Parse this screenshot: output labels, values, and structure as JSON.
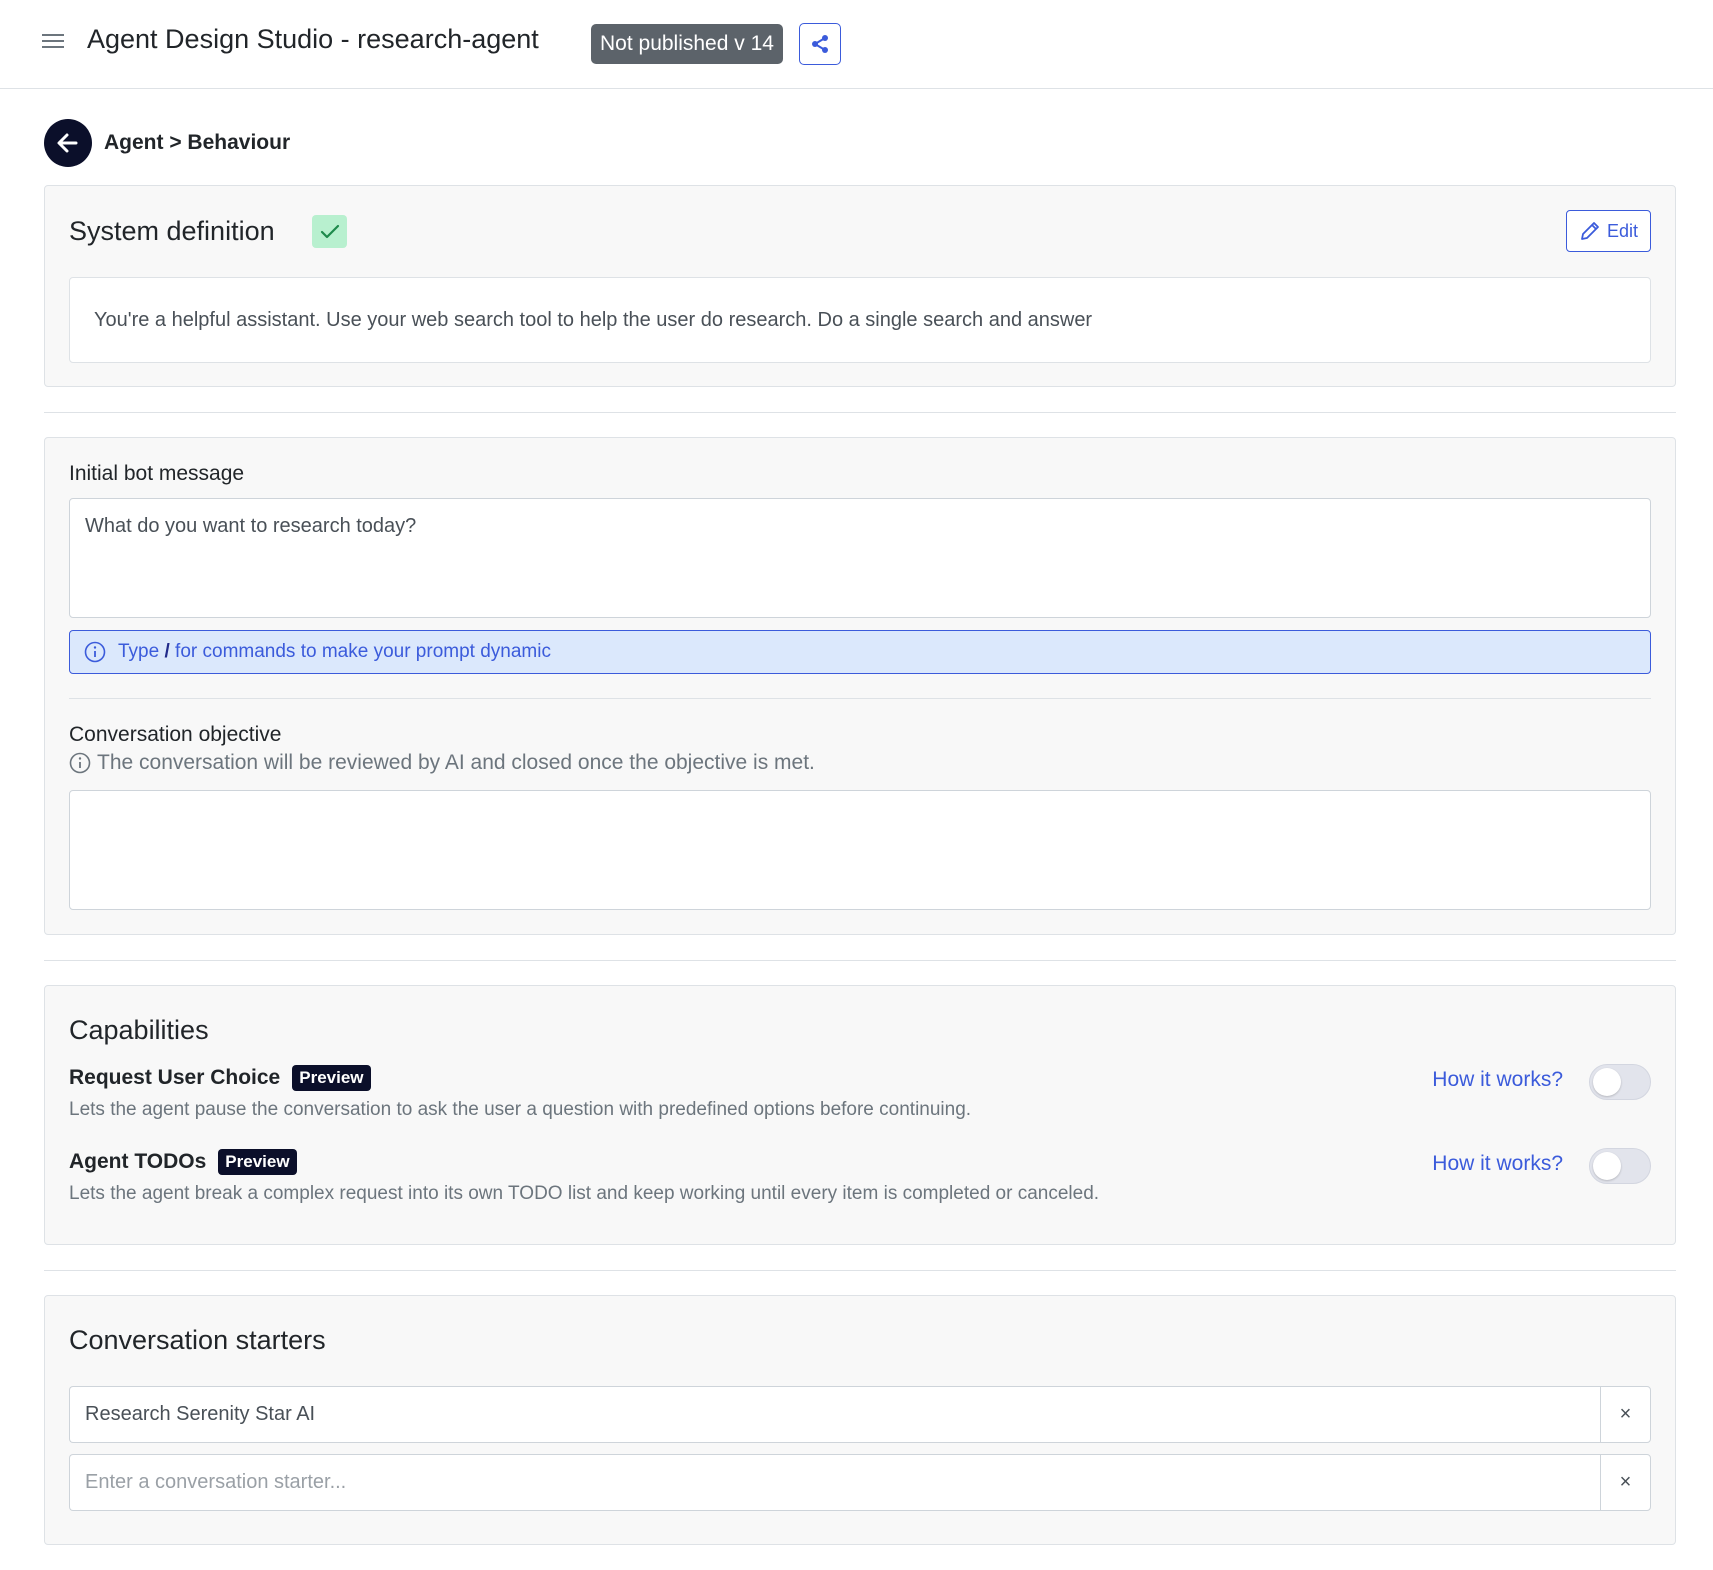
{
  "header": {
    "menu_icon": "hamburger-menu-icon",
    "title": "Agent Design Studio - research-agent",
    "status_badge": "Not published v 14",
    "share_icon": "share-icon"
  },
  "breadcrumb": {
    "back_icon": "arrow-left-icon",
    "text": "Agent > Behaviour"
  },
  "system_definition": {
    "title": "System definition",
    "status_icon": "check-icon",
    "edit_label": "Edit",
    "text": "You're a helpful assistant. Use your web search tool to help the user do research. Do a single search and answer"
  },
  "initial_message": {
    "label": "Initial bot message",
    "value": "What do you want to research today?",
    "info_type": "Type",
    "info_slash": "/",
    "info_rest": "for commands to make your prompt dynamic"
  },
  "objective": {
    "label": "Conversation objective",
    "hint": "The conversation will be reviewed by AI and closed once the objective is met.",
    "value": ""
  },
  "capabilities": {
    "title": "Capabilities",
    "items": [
      {
        "name": "Request User Choice",
        "badge": "Preview",
        "description": "Lets the agent pause the conversation to ask the user a question with predefined options before continuing.",
        "link": "How it works?",
        "enabled": false
      },
      {
        "name": "Agent TODOs",
        "badge": "Preview",
        "description": "Lets the agent break a complex request into its own TODO list and keep working until every item is completed or canceled.",
        "link": "How it works?",
        "enabled": false
      }
    ]
  },
  "starters": {
    "title": "Conversation starters",
    "items": [
      {
        "value": "Research Serenity Star AI",
        "placeholder": "Enter a conversation starter..."
      },
      {
        "value": "",
        "placeholder": "Enter a conversation starter..."
      }
    ],
    "remove_label": "×"
  },
  "colors": {
    "accent": "#3b5bdb",
    "dark": "#0b0f2a",
    "badge_bg": "#5c636a",
    "success_bg": "#b8f0cf",
    "info_bg": "#dbe8fc"
  }
}
